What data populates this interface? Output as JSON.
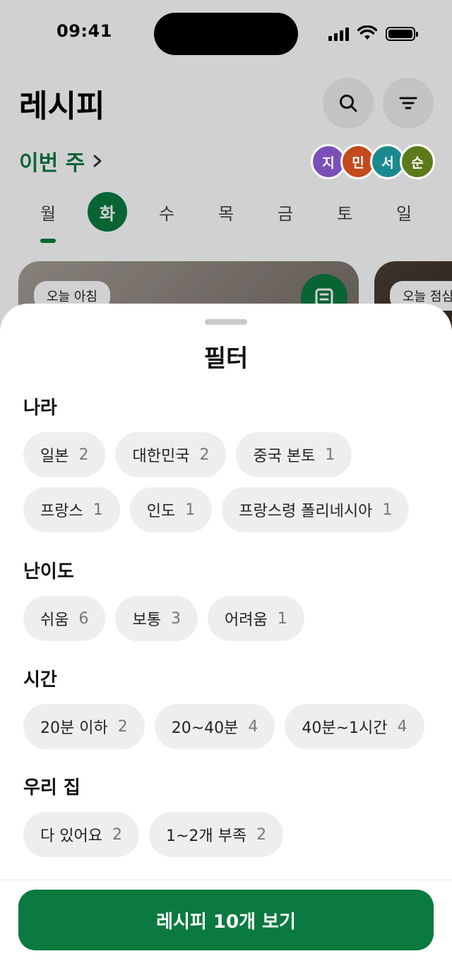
{
  "status_bar": {
    "time": "09:41"
  },
  "header": {
    "title": "레시피",
    "week_label": "이번 주"
  },
  "avatars": [
    {
      "initial": "지",
      "color": "#7b4fb8"
    },
    {
      "initial": "민",
      "color": "#c24a1c"
    },
    {
      "initial": "서",
      "color": "#1a8a8f"
    },
    {
      "initial": "순",
      "color": "#5d7a1a"
    }
  ],
  "days": [
    {
      "label": "월",
      "active": false
    },
    {
      "label": "화",
      "active": true
    },
    {
      "label": "수",
      "active": false
    },
    {
      "label": "목",
      "active": false
    },
    {
      "label": "금",
      "active": false
    },
    {
      "label": "토",
      "active": false
    },
    {
      "label": "일",
      "active": false
    }
  ],
  "cards": [
    {
      "tag": "오늘 아침"
    },
    {
      "tag": "오늘 점심"
    }
  ],
  "sheet": {
    "title": "필터",
    "sections": [
      {
        "title": "나라",
        "chips": [
          {
            "label": "일본",
            "count": "2"
          },
          {
            "label": "대한민국",
            "count": "2"
          },
          {
            "label": "중국 본토",
            "count": "1"
          },
          {
            "label": "프랑스",
            "count": "1"
          },
          {
            "label": "인도",
            "count": "1"
          },
          {
            "label": "프랑스령 폴리네시아",
            "count": "1"
          }
        ]
      },
      {
        "title": "난이도",
        "chips": [
          {
            "label": "쉬움",
            "count": "6"
          },
          {
            "label": "보통",
            "count": "3"
          },
          {
            "label": "어려움",
            "count": "1"
          }
        ]
      },
      {
        "title": "시간",
        "chips": [
          {
            "label": "20분 이하",
            "count": "2"
          },
          {
            "label": "20~40분",
            "count": "4"
          },
          {
            "label": "40분~1시간",
            "count": "4"
          }
        ]
      },
      {
        "title": "우리 집",
        "chips": [
          {
            "label": "다 있어요",
            "count": "2"
          },
          {
            "label": "1~2개 부족",
            "count": "2"
          }
        ]
      }
    ],
    "cta_label": "레시피 10개 보기"
  },
  "colors": {
    "accent": "#0b7a40",
    "chip_bg": "#eeeeee"
  }
}
